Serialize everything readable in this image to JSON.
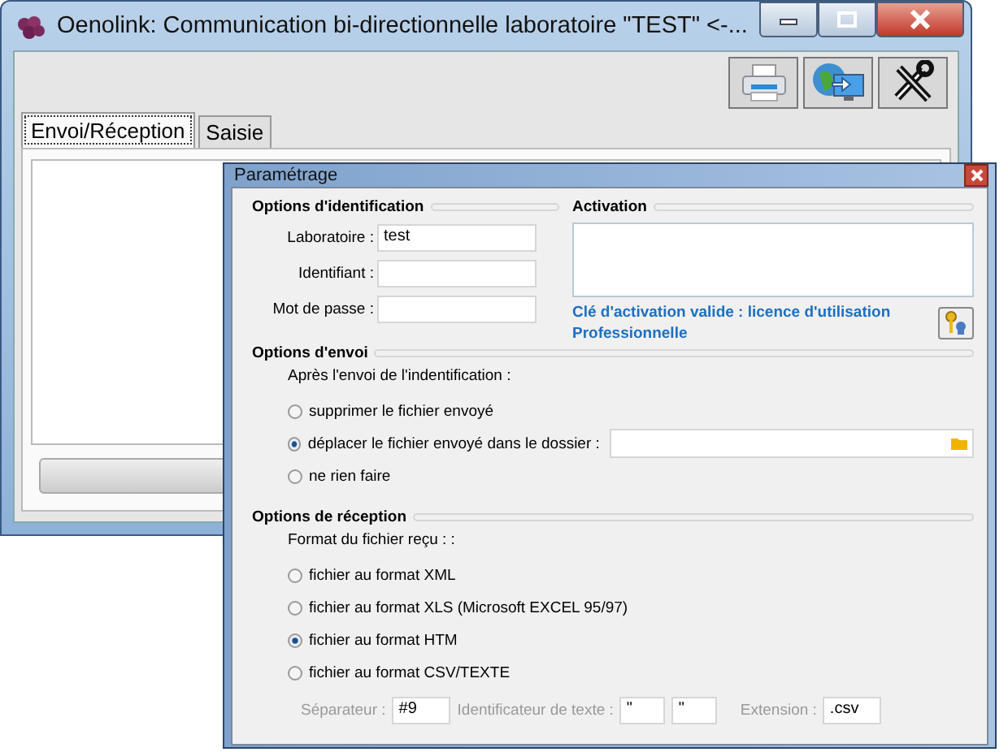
{
  "main_window": {
    "title": "Oenolink: Communication bi-directionnelle laboratoire \"TEST\" <-...",
    "tabs": [
      {
        "label": "Envoi/Réception",
        "selected": true
      },
      {
        "label": "Saisie",
        "selected": false
      }
    ]
  },
  "dialog": {
    "title": "Paramétrage",
    "identification": {
      "heading": "Options d'identification",
      "fields": [
        {
          "label": "Laboratoire :",
          "value": "test"
        },
        {
          "label": "Identifiant :"
        },
        {
          "label": "Mot de passe :"
        }
      ]
    },
    "activation": {
      "heading": "Activation",
      "status": "Clé d'activation valide : licence d'utilisation Professionnelle"
    },
    "envoi": {
      "heading": "Options d'envoi",
      "prompt": "Après l'envoi de l'indentification  :",
      "options": [
        {
          "label": "supprimer le fichier envoyé",
          "selected": false
        },
        {
          "label": "déplacer le fichier envoyé dans le dossier :",
          "selected": true
        },
        {
          "label": "ne rien faire",
          "selected": false
        }
      ]
    },
    "reception": {
      "heading": "Options de réception",
      "prompt": "Format du fichier reçu :  :",
      "options": [
        {
          "label": "fichier au format XML",
          "selected": false
        },
        {
          "label": "fichier au format XLS (Microsoft EXCEL 95/97)",
          "selected": false
        },
        {
          "label": "fichier au format HTM",
          "selected": true
        },
        {
          "label": "fichier au format CSV/TEXTE",
          "selected": false
        }
      ],
      "csv": {
        "disabled": true,
        "separator_label": "Séparateur :",
        "separator": "#9",
        "text_id_label": "Identificateur de texte :",
        "text_id_open": "\"",
        "text_id_close": "\"",
        "extension_label": "Extension :",
        "extension": ".csv"
      }
    }
  }
}
